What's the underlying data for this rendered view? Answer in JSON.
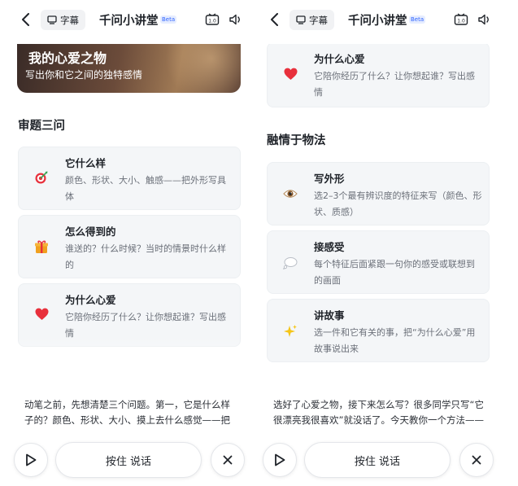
{
  "topbar": {
    "subtitle_label": "字幕",
    "title": "千问小讲堂",
    "beta": "Beta",
    "icons": [
      "back-icon",
      "subtitle-icon",
      "captions-cc-icon",
      "speaker-icon"
    ]
  },
  "left": {
    "hero": {
      "title": "我的心爱之物",
      "subtitle": "写出你和它之间的独特感情"
    },
    "section_title": "审题三问",
    "cards": [
      {
        "icon": "dart-target-icon",
        "title": "它什么样",
        "desc": "颜色、形状、大小、触感——把外形写具体"
      },
      {
        "icon": "gift-icon",
        "title": "怎么得到的",
        "desc": "谁送的？什么时候？当时的情景时什么样的"
      },
      {
        "icon": "heart-icon",
        "title": "为什么心爱",
        "desc": "它陪你经历了什么？让你想起谁？写出感情"
      }
    ],
    "caption": "动笔之前，先想清楚三个问题。第一，它是什么样子的？颜色、形状、大小、摸上去什么感觉——把"
  },
  "right": {
    "top_card": {
      "icon": "heart-icon",
      "title": "为什么心爱",
      "desc": "它陪你经历了什么？让你想起谁？写出感情"
    },
    "section_title": "融情于物法",
    "cards": [
      {
        "icon": "eye-icon",
        "title": "写外形",
        "desc": "选2–3个最有辨识度的特征来写（颜色、形状、质感）"
      },
      {
        "icon": "thought-bubble-icon",
        "title": "接感受",
        "desc": "每个特征后面紧跟一句你的感受或联想到的画面"
      },
      {
        "icon": "sparkles-icon",
        "title": "讲故事",
        "desc": "选一件和它有关的事，把“为什么心爱”用故事说出来"
      }
    ],
    "caption": "选好了心爱之物，接下来怎么写？很多同学只写“它很漂亮我很喜欢”就没话了。今天教你一个方法——"
  },
  "bottombar": {
    "talk_label": "按住 说话",
    "icons": [
      "play-icon",
      "close-icon"
    ]
  },
  "colors": {
    "card_bg": "#f4f6f8",
    "beta_badge": "#2f64ff",
    "heart": "#e8303c",
    "gift": "#f0a020"
  }
}
